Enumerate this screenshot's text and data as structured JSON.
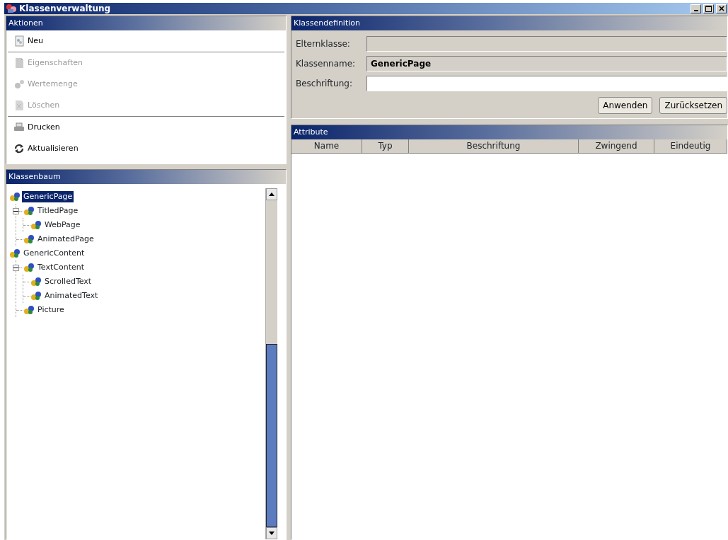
{
  "window": {
    "title": "Klassenverwaltung"
  },
  "actions": {
    "title": "Aktionen",
    "groups": [
      [
        {
          "label": "Neu",
          "disabled": false
        }
      ],
      [
        {
          "label": "Eigenschaften",
          "disabled": true
        },
        {
          "label": "Wertemenge",
          "disabled": true
        },
        {
          "label": "Löschen",
          "disabled": true
        }
      ],
      [
        {
          "label": "Drucken",
          "disabled": false
        },
        {
          "label": "Aktualisieren",
          "disabled": false
        }
      ]
    ]
  },
  "class_tree": {
    "title": "Klassenbaum",
    "items": [
      {
        "label": "GenericPage",
        "selected": true,
        "expanded": true,
        "children": [
          {
            "label": "TitledPage",
            "selected": false,
            "expanded": true,
            "children": [
              {
                "label": "WebPage",
                "selected": false
              }
            ]
          },
          {
            "label": "AnimatedPage",
            "selected": false
          }
        ]
      },
      {
        "label": "GenericContent",
        "selected": false,
        "expanded": true,
        "children": [
          {
            "label": "TextContent",
            "selected": false,
            "expanded": true,
            "children": [
              {
                "label": "ScrolledText",
                "selected": false
              },
              {
                "label": "AnimatedText",
                "selected": false
              }
            ]
          },
          {
            "label": "Picture",
            "selected": false
          }
        ]
      }
    ]
  },
  "class_definition": {
    "title": "Klassendefinition",
    "fields": [
      {
        "label": "Elternklasse:",
        "readonly": true
      },
      {
        "label": "Klassenname:",
        "readonly": true,
        "value": "GenericPage"
      },
      {
        "label": "Beschriftung:",
        "readonly": false
      }
    ],
    "buttons": [
      "Anwenden",
      "Zurücksetzen"
    ]
  },
  "attributes": {
    "title": "Attribute",
    "columns": [
      "Name",
      "Typ",
      "Beschriftung",
      "Zwingend",
      "Eindeutig"
    ]
  }
}
